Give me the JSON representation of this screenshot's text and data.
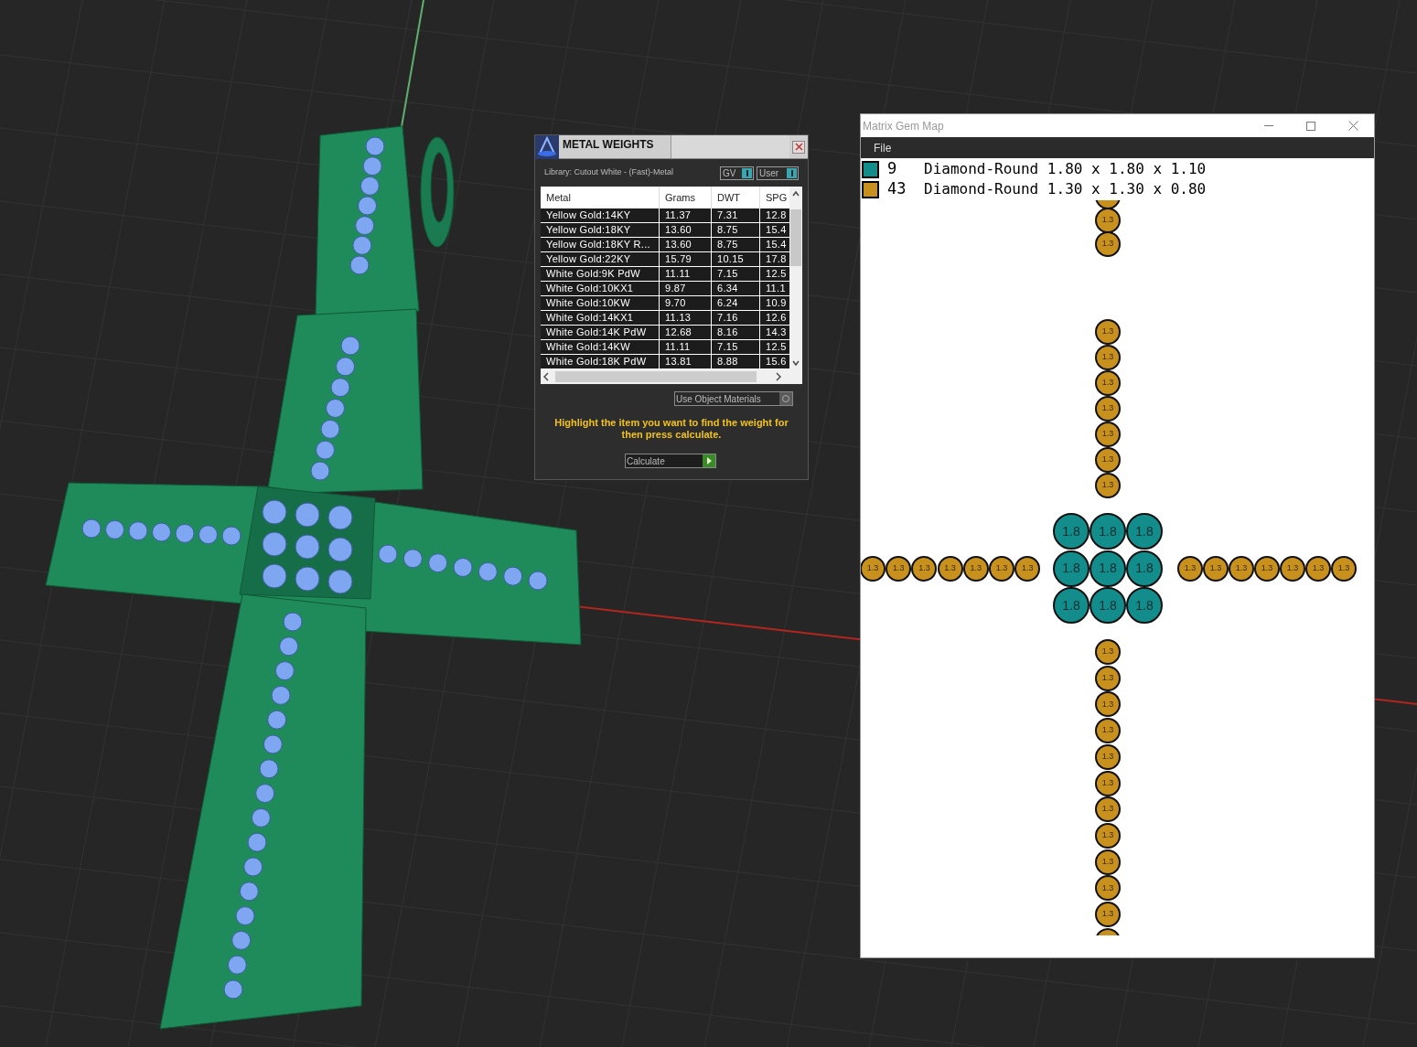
{
  "metal_weights": {
    "title": "METAL WEIGHTS",
    "library": "Library: Cutout White - (Fast)-Metal",
    "toggles": [
      {
        "label": "GV",
        "on": true
      },
      {
        "label": "User",
        "on": true
      }
    ],
    "columns": [
      "Metal",
      "Grams",
      "DWT",
      "SPG"
    ],
    "rows": [
      [
        "Yellow Gold:14KY",
        "11.37",
        "7.31",
        "12.8"
      ],
      [
        "Yellow Gold:18KY",
        "13.60",
        "8.75",
        "15.4"
      ],
      [
        "Yellow Gold:18KY R...",
        "13.60",
        "8.75",
        "15.4"
      ],
      [
        "Yellow Gold:22KY",
        "15.79",
        "10.15",
        "17.8"
      ],
      [
        "White Gold:9K PdW",
        "11.11",
        "7.15",
        "12.5"
      ],
      [
        "White Gold:10KX1",
        "9.87",
        "6.34",
        "11.1"
      ],
      [
        "White Gold:10KW",
        "9.70",
        "6.24",
        "10.9"
      ],
      [
        "White Gold:14KX1",
        "11.13",
        "7.16",
        "12.6"
      ],
      [
        "White Gold:14K PdW",
        "12.68",
        "8.16",
        "14.3"
      ],
      [
        "White Gold:14KW",
        "11.11",
        "7.15",
        "12.5"
      ],
      [
        "White Gold:18K PdW",
        "13.81",
        "8.88",
        "15.6"
      ]
    ],
    "use_object_materials": {
      "label": "Use Object Materials",
      "checked": false
    },
    "hint": "Highlight the item you want to find the weight for then press calculate.",
    "calculate": "Calculate"
  },
  "gem_map": {
    "title": "Matrix Gem Map",
    "menu": [
      "File"
    ],
    "legend": [
      {
        "count": "9",
        "description": "Diamond-Round 1.80 x 1.80 x 1.10",
        "color": "#138c8c"
      },
      {
        "count": "43",
        "description": "Diamond-Round 1.30 x 1.30 x 0.80",
        "color": "#c8911e"
      }
    ],
    "arms": {
      "top_upper": [
        {
          "color": "#c8911e"
        },
        {
          "label": "1.3",
          "color": "#c8911e"
        },
        {
          "label": "1.3",
          "color": "#c8911e"
        }
      ],
      "top_lower": [
        {
          "label": "1.3",
          "color": "#c8911e"
        },
        {
          "label": "1.3",
          "color": "#c8911e"
        },
        {
          "label": "1.3",
          "color": "#c8911e"
        },
        {
          "label": "1.3",
          "color": "#c8911e"
        },
        {
          "label": "1.3",
          "color": "#c8911e"
        },
        {
          "label": "1.3",
          "color": "#c8911e"
        },
        {
          "label": "1.3",
          "color": "#c8911e"
        }
      ],
      "left": [
        {
          "label": "1.3",
          "color": "#c8911e"
        },
        {
          "label": "1.3",
          "color": "#c8911e"
        },
        {
          "label": "1.3",
          "color": "#c8911e"
        },
        {
          "label": "1.3",
          "color": "#c8911e"
        },
        {
          "label": "1.3",
          "color": "#c8911e"
        },
        {
          "label": "1.3",
          "color": "#c8911e"
        },
        {
          "label": "1.3",
          "color": "#c8911e"
        }
      ],
      "center": [
        {
          "label": "1.8",
          "color": "#138c8c"
        },
        {
          "label": "1.8",
          "color": "#138c8c"
        },
        {
          "label": "1.8",
          "color": "#138c8c"
        },
        {
          "label": "1.8",
          "color": "#138c8c"
        },
        {
          "label": "1.8",
          "color": "#138c8c"
        },
        {
          "label": "1.8",
          "color": "#138c8c"
        },
        {
          "label": "1.8",
          "color": "#138c8c"
        },
        {
          "label": "1.8",
          "color": "#138c8c"
        },
        {
          "label": "1.8",
          "color": "#138c8c"
        }
      ],
      "right": [
        {
          "label": "1.3",
          "color": "#c8911e"
        },
        {
          "label": "1.3",
          "color": "#c8911e"
        },
        {
          "label": "1.3",
          "color": "#c8911e"
        },
        {
          "label": "1.3",
          "color": "#c8911e"
        },
        {
          "label": "1.3",
          "color": "#c8911e"
        },
        {
          "label": "1.3",
          "color": "#c8911e"
        },
        {
          "label": "1.3",
          "color": "#c8911e"
        }
      ],
      "bottom": [
        {
          "label": "1.3",
          "color": "#c8911e"
        },
        {
          "label": "1.3",
          "color": "#c8911e"
        },
        {
          "label": "1.3",
          "color": "#c8911e"
        },
        {
          "label": "1.3",
          "color": "#c8911e"
        },
        {
          "label": "1.3",
          "color": "#c8911e"
        },
        {
          "label": "1.3",
          "color": "#c8911e"
        },
        {
          "label": "1.3",
          "color": "#c8911e"
        },
        {
          "label": "1.3",
          "color": "#c8911e"
        },
        {
          "label": "1.3",
          "color": "#c8911e"
        },
        {
          "label": "1.3",
          "color": "#c8911e"
        },
        {
          "label": "1.3",
          "color": "#c8911e"
        },
        {
          "color": "#c8911e"
        }
      ]
    }
  }
}
